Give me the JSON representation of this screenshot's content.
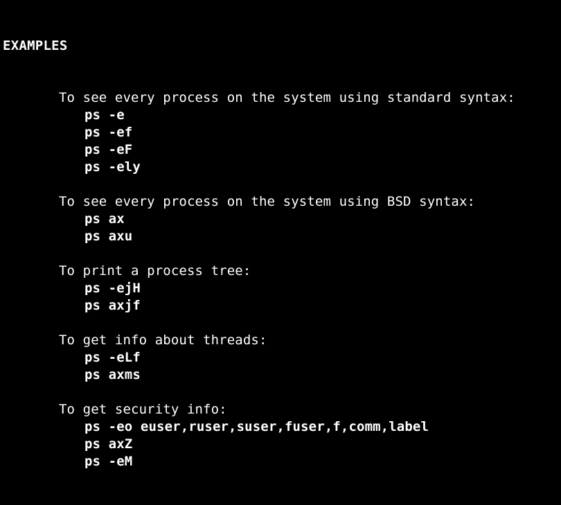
{
  "terminal": {
    "background_color": "#000000",
    "foreground_color": "#ffffff"
  },
  "manpage": {
    "section_heading": "EXAMPLES",
    "blocks": [
      {
        "description": "To see every process on the system using standard syntax:",
        "commands": [
          "ps -e",
          "ps -ef",
          "ps -eF",
          "ps -ely"
        ]
      },
      {
        "description": "To see every process on the system using BSD syntax:",
        "commands": [
          "ps ax",
          "ps axu"
        ]
      },
      {
        "description": "To print a process tree:",
        "commands": [
          "ps -ejH",
          "ps axjf"
        ]
      },
      {
        "description": "To get info about threads:",
        "commands": [
          "ps -eLf",
          "ps axms"
        ]
      },
      {
        "description": "To get security info:",
        "commands": [
          "ps -eo euser,ruser,suser,fuser,f,comm,label",
          "ps axZ",
          "ps -eM"
        ]
      }
    ]
  }
}
